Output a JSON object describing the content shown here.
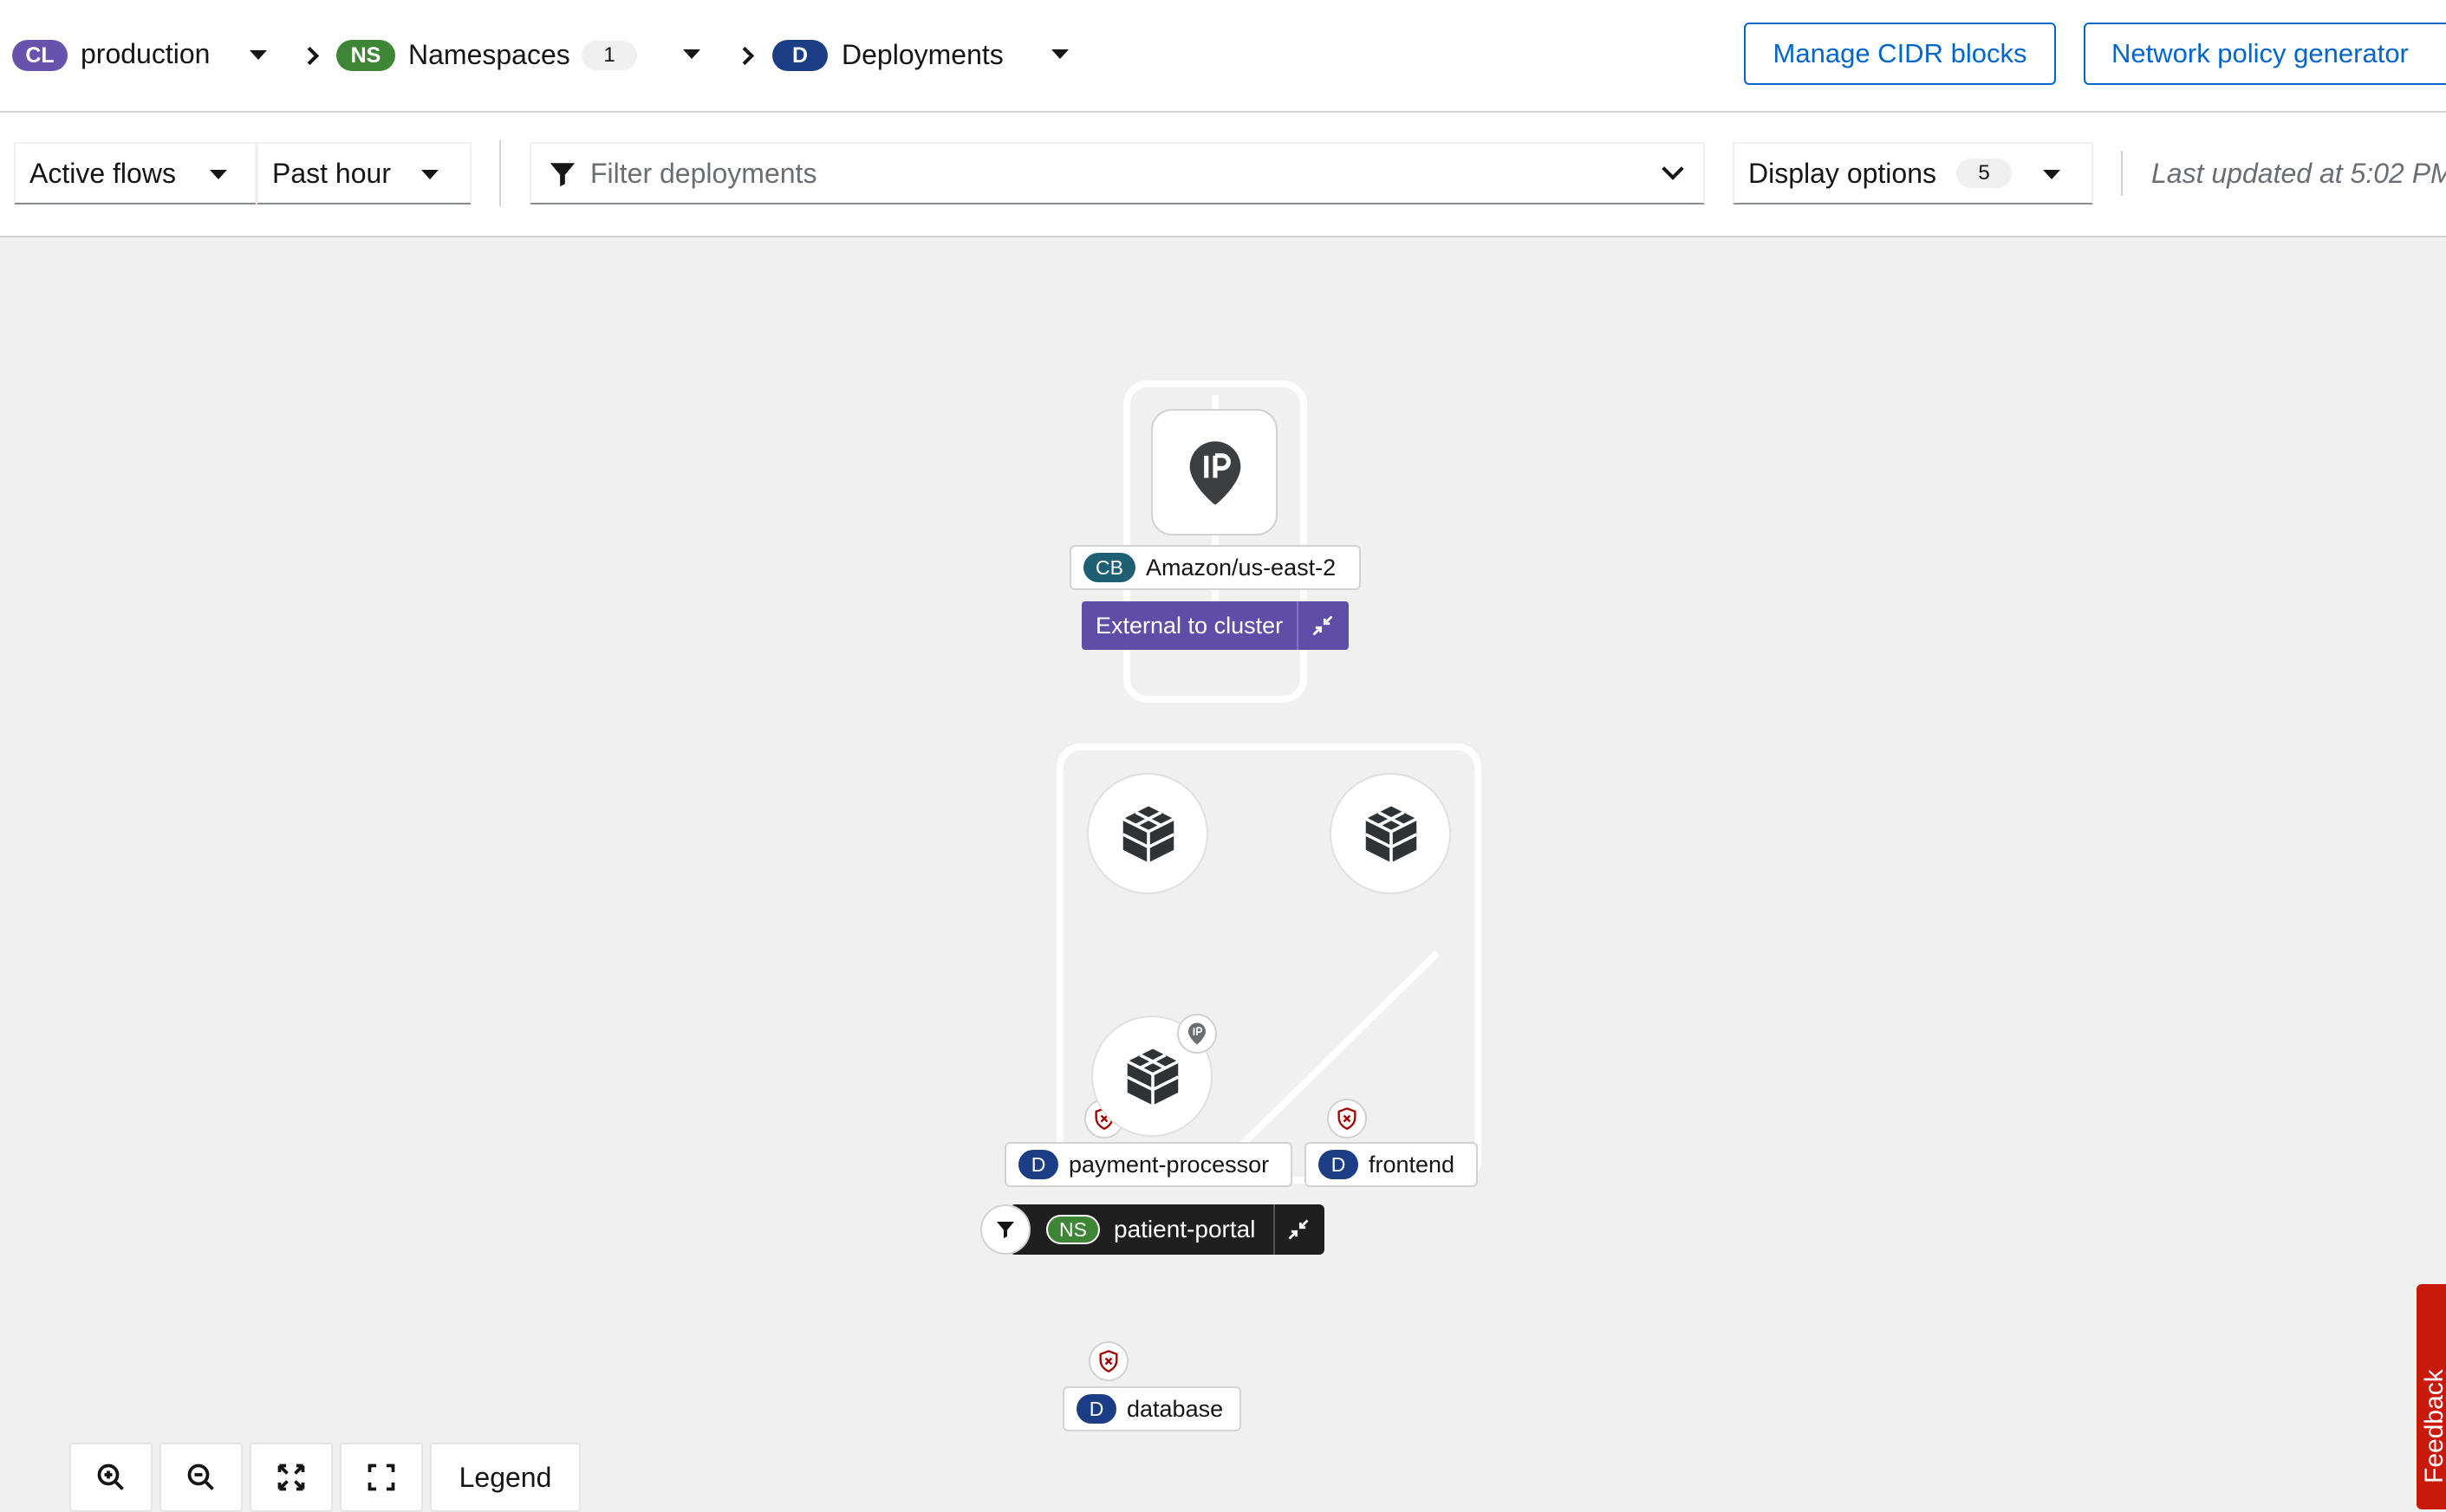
{
  "breadcrumb": {
    "cluster": {
      "badge": "CL",
      "name": "production"
    },
    "namespaces": {
      "badge": "NS",
      "label": "Namespaces",
      "count": "1"
    },
    "deployments": {
      "badge": "D",
      "label": "Deployments"
    }
  },
  "header_buttons": {
    "manage_cidr": "Manage CIDR blocks",
    "policy_generator": "Network policy generator"
  },
  "toolbar": {
    "flows_select": "Active flows",
    "time_select": "Past hour",
    "filter_placeholder": "Filter deployments",
    "display_options": "Display options",
    "display_options_count": "5",
    "last_updated": "Last updated at 5:02 PM"
  },
  "graph": {
    "external_group": {
      "node_badge": "CB",
      "node_name": "Amazon/us-east-2",
      "group_label": "External to cluster"
    },
    "namespace_group": {
      "badge": "NS",
      "name": "patient-portal",
      "deployments": [
        {
          "badge": "D",
          "name": "payment-processor"
        },
        {
          "badge": "D",
          "name": "frontend"
        },
        {
          "badge": "D",
          "name": "database"
        }
      ]
    }
  },
  "controls": {
    "legend": "Legend"
  },
  "feedback_label": "Feedback",
  "colors": {
    "cluster_badge": "#6753ac",
    "namespace_badge": "#3e8635",
    "deployment_badge": "#1a3d85",
    "cidr_badge": "#1f5f73",
    "link_blue": "#0066cc",
    "external_group": "#5e4ea8",
    "namespace_group": "#1f1f1f",
    "shield_red": "#a30000",
    "feedback_red": "#c9190b"
  },
  "icons": {
    "filter": "filter-icon",
    "ip": "ip-marker-icon",
    "deployment": "deployment-cube-icon",
    "shield": "shield-x-icon",
    "collapse": "collapse-arrows-icon",
    "zoom_in": "zoom-in-icon",
    "zoom_out": "zoom-out-icon",
    "fit": "fit-to-screen-icon",
    "reset": "reset-view-icon"
  }
}
